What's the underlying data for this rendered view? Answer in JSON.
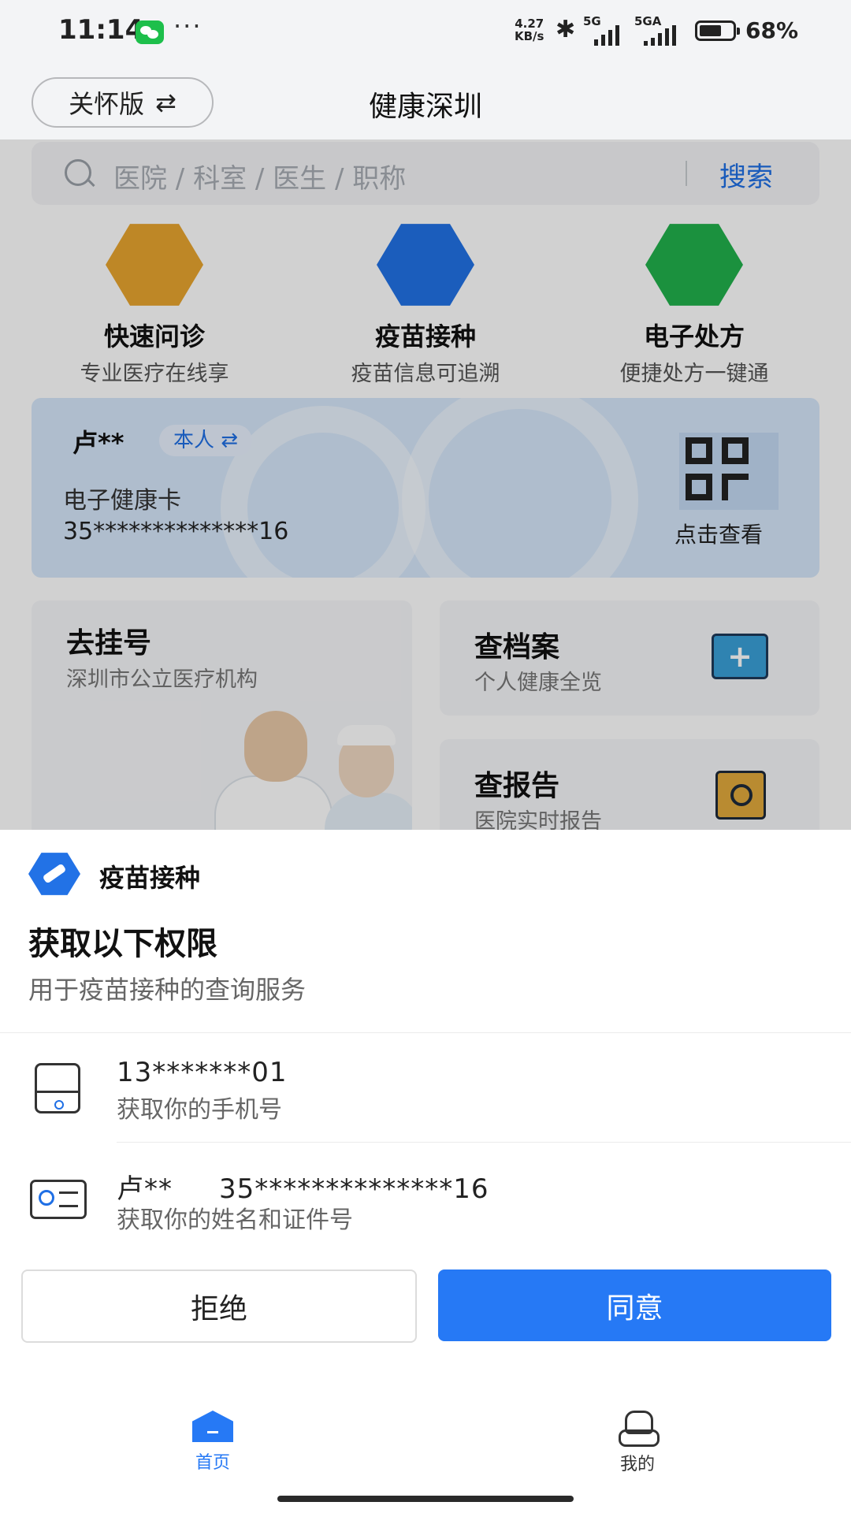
{
  "status_bar": {
    "time": "11:14",
    "more": "···",
    "net_speed_value": "4.27",
    "net_speed_unit": "KB/s",
    "sim1": "5G",
    "sim2": "5GA",
    "battery": "68%"
  },
  "header": {
    "care_mode_label": "关怀版",
    "care_mode_icon": "⇄",
    "title": "健康深圳"
  },
  "search": {
    "placeholder": "医院 / 科室 / 医生 / 职称",
    "button": "搜索"
  },
  "services": [
    {
      "title": "快速问诊",
      "subtitle": "专业医疗在线享",
      "icon": "chat-bolt-icon",
      "color": "#E8A52F"
    },
    {
      "title": "疫苗接种",
      "subtitle": "疫苗信息可追溯",
      "icon": "syringe-icon",
      "color": "#2272E6"
    },
    {
      "title": "电子处方",
      "subtitle": "便捷处方一键通",
      "icon": "prescription-icon",
      "color": "#22B14C"
    }
  ],
  "health_card": {
    "name": "卢**",
    "relation": "本人 ⇄",
    "label": "电子健康卡",
    "id_number": "35**************16",
    "view": "点击查看"
  },
  "cards": {
    "register": {
      "title": "去挂号",
      "subtitle": "深圳市公立医疗机构"
    },
    "records": {
      "title": "查档案",
      "subtitle": "个人健康全览"
    },
    "reports": {
      "title": "查报告",
      "subtitle": "医院实时报告"
    }
  },
  "sheet": {
    "app_name": "疫苗接种",
    "title": "获取以下权限",
    "description": "用于疫苗接种的查询服务",
    "permissions": [
      {
        "value": "13*******01",
        "description": "获取你的手机号"
      },
      {
        "value": "卢**     35**************16",
        "description": "获取你的姓名和证件号"
      }
    ],
    "reject": "拒绝",
    "agree": "同意"
  },
  "tabbar": {
    "items": [
      {
        "label": "首页",
        "active": true
      },
      {
        "label": "我的",
        "active": false
      }
    ]
  },
  "colors": {
    "accent": "#2679F5",
    "link": "#1F6FE5"
  }
}
